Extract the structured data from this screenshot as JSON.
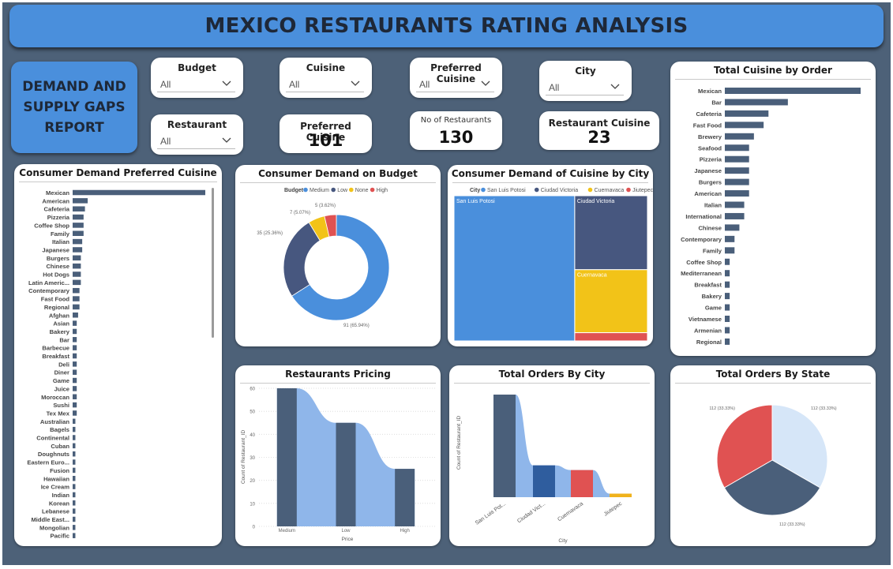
{
  "header": {
    "title": "MEXICO RESTAURANTS RATING ANALYSIS"
  },
  "report_label": "DEMAND AND\nSUPPLY GAPS\nREPORT",
  "slicers": {
    "budget": {
      "label": "Budget",
      "value": "All"
    },
    "cuisine": {
      "label": "Cuisine",
      "value": "All"
    },
    "preferred_cuisine": {
      "label": "Preferred Cuisine",
      "value": "All"
    },
    "city": {
      "label": "City",
      "value": "All"
    },
    "restaurant": {
      "label": "Restaurant",
      "value": "All"
    }
  },
  "cards": {
    "preferred_cuisine": {
      "label": "Preferred Cuisine",
      "value": "101"
    },
    "no_of_restaurants": {
      "label": "No of Restaurants",
      "value": "130"
    },
    "restaurant_cuisine": {
      "label": "Restaurant Cuisine",
      "value": "23"
    }
  },
  "colors": {
    "bar": "#4a5f7a",
    "medium": "#4a8fdc",
    "low": "#47577f",
    "none": "#f2c318",
    "high": "#e05252",
    "area": "#8fb6ea",
    "jiutepec": "#f0b21c",
    "state_light": "#d6e6f8"
  },
  "chart_data": [
    {
      "id": "preferred",
      "type": "bar",
      "orientation": "horizontal",
      "title": "Consumer Demand Preferred Cuisine",
      "categories": [
        "Mexican",
        "American",
        "Cafeteria",
        "Pizzeria",
        "Coffee Shop",
        "Family",
        "Italian",
        "Japanese",
        "Burgers",
        "Chinese",
        "Hot Dogs",
        "Latin Americ...",
        "Contemporary",
        "Fast Food",
        "Regional",
        "Afghan",
        "Asian",
        "Bakery",
        "Bar",
        "Barbecue",
        "Breakfast",
        "Deli",
        "Diner",
        "Game",
        "Juice",
        "Moroccan",
        "Sushi",
        "Tex Mex",
        "Australian",
        "Bagels",
        "Continental",
        "Cuban",
        "Doughnuts",
        "Eastern Euro...",
        "Fusion",
        "Hawaiian",
        "Ice Cream",
        "Indian",
        "Korean",
        "Lebanese",
        "Middle East...",
        "Mongolian",
        "Pacific"
      ],
      "values": [
        97,
        11,
        9,
        8,
        8,
        8,
        7,
        7,
        6,
        6,
        6,
        6,
        5,
        5,
        5,
        4,
        3,
        3,
        3,
        3,
        3,
        3,
        3,
        3,
        3,
        3,
        3,
        3,
        2,
        2,
        2,
        2,
        2,
        2,
        2,
        2,
        2,
        2,
        2,
        2,
        2,
        2,
        2
      ]
    },
    {
      "id": "budget",
      "type": "pie",
      "donut": true,
      "title": "Consumer Demand on Budget",
      "legend_title": "Budget",
      "categories": [
        "Medium",
        "Low",
        "None",
        "High"
      ],
      "values": [
        91,
        35,
        7,
        5
      ],
      "labels": [
        "91 (65.94%)",
        "35 (25.36%)",
        "7 (5.07%)",
        "5 (3.62%)"
      ]
    },
    {
      "id": "city_demand",
      "type": "heatmap",
      "subtype": "treemap",
      "title": "Consumer Demand of Cuisine by City",
      "legend_title": "City",
      "categories": [
        "San Luis Potosi",
        "Ciudad Victoria",
        "Cuernavaca",
        "Jiutepec"
      ],
      "values": [
        88,
        27,
        23,
        3
      ]
    },
    {
      "id": "pricing",
      "type": "bar",
      "title": "Restaurants Pricing",
      "xlabel": "Price",
      "ylabel": "Count of Restaurant_ID",
      "categories": [
        "Medium",
        "Low",
        "High"
      ],
      "values": [
        60,
        45,
        25
      ],
      "ylim": [
        0,
        60
      ],
      "yticks": [
        0,
        10,
        20,
        30,
        40,
        50,
        60
      ],
      "grid": true
    },
    {
      "id": "orders_city",
      "type": "bar",
      "title": "Total Orders By City",
      "xlabel": "City",
      "ylabel": "Count of Restaurant_ID",
      "categories": [
        "San Luis Pot...",
        "Ciudad Vict...",
        "Cuernavaca",
        "Jiutepec"
      ],
      "values": [
        87,
        27,
        23,
        3
      ]
    },
    {
      "id": "orders_state",
      "type": "pie",
      "title": "Total Orders By State",
      "values": [
        112,
        112,
        112
      ],
      "labels": [
        "112 (33.33%)",
        "112 (33.33%)",
        "112 (33.33%)"
      ]
    },
    {
      "id": "cuisine_order",
      "type": "bar",
      "orientation": "horizontal",
      "title": "Total Cuisine by Order",
      "categories": [
        "Mexican",
        "Bar",
        "Cafeteria",
        "Fast Food",
        "Brewery",
        "Seafood",
        "Pizzeria",
        "Japanese",
        "Burgers",
        "American",
        "Italian",
        "International",
        "Chinese",
        "Contemporary",
        "Family",
        "Coffee Shop",
        "Mediterranean",
        "Breakfast",
        "Bakery",
        "Game",
        "Vietnamese",
        "Armenian",
        "Regional"
      ],
      "values": [
        28,
        13,
        9,
        8,
        6,
        5,
        5,
        5,
        5,
        5,
        4,
        4,
        3,
        2,
        2,
        1,
        1,
        1,
        1,
        1,
        1,
        1,
        1
      ]
    }
  ]
}
